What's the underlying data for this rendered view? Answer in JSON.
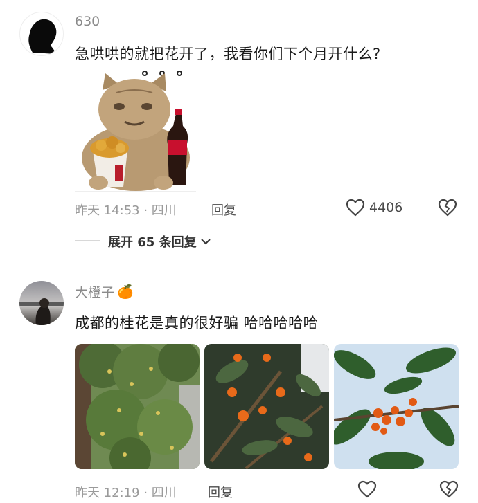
{
  "comments": [
    {
      "username": "630",
      "text": "急哄哄的就把花开了，我看你们下个月开什么?",
      "meta": "昨天 14:53 · 四川",
      "reply_label": "回复",
      "like_count": "4406",
      "expand_label": "展开 65 条回复"
    },
    {
      "username": "大橙子",
      "name_emoji": "🍊",
      "text": "成都的桂花是真的很好骗 哈哈哈哈哈",
      "meta": "昨天 12:19 · 四川",
      "reply_label": "回复"
    }
  ],
  "icons": {
    "like": "heart-outline-icon",
    "dislike": "broken-heart-icon",
    "expand": "chevron-down-icon"
  },
  "colors": {
    "meta_gray": "#9a9a9a",
    "text_dark": "#1a1a1a",
    "cola_red": "#c8102e",
    "osmanthus_orange": "#e86a1a"
  }
}
